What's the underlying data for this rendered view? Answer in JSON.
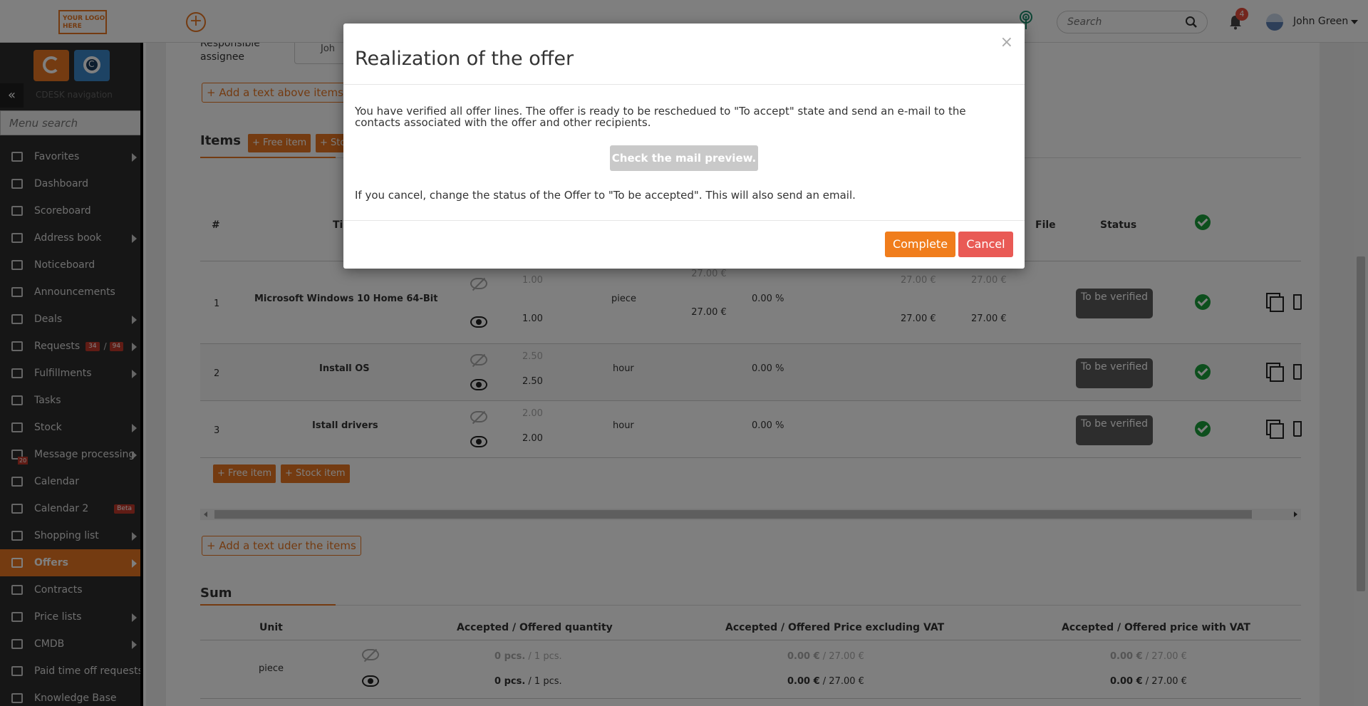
{
  "header": {
    "logo_line1": "YOUR LOGO",
    "logo_line2": "HERE",
    "search_placeholder": "Search",
    "notifications_count": "4",
    "user_name": "John Green"
  },
  "sidebar": {
    "nav_caption": "CDESK navigation",
    "menu_search_placeholder": "Menu search",
    "items": [
      {
        "label": "Favorites",
        "icon": "star-icon",
        "arrow": true
      },
      {
        "label": "Dashboard",
        "icon": "bar-chart-icon",
        "arrow": false
      },
      {
        "label": "Scoreboard",
        "icon": "line-chart-icon",
        "arrow": false
      },
      {
        "label": "Address book",
        "icon": "user-icon",
        "arrow": true
      },
      {
        "label": "Noticeboard",
        "icon": "paper-plane-icon",
        "arrow": false
      },
      {
        "label": "Announcements",
        "icon": "megaphone-icon",
        "arrow": false
      },
      {
        "label": "Deals",
        "icon": "credit-card-icon",
        "arrow": true
      },
      {
        "label": "Requests",
        "icon": "check-circle-icon",
        "arrow": true,
        "badge1": "34",
        "badge2": "94"
      },
      {
        "label": "Fulfillments",
        "icon": "box-icon",
        "arrow": true
      },
      {
        "label": "Tasks",
        "icon": "list-icon",
        "arrow": false
      },
      {
        "label": "Stock",
        "icon": "archive-icon",
        "arrow": true
      },
      {
        "label": "Message processing",
        "icon": "envelope-icon",
        "arrow": true,
        "count": "20"
      },
      {
        "label": "Calendar",
        "icon": "calendar-icon",
        "arrow": false
      },
      {
        "label": "Calendar 2",
        "icon": "calendar-icon",
        "arrow": false,
        "beta": "Beta"
      },
      {
        "label": "Shopping list",
        "icon": "cart-icon",
        "arrow": true
      },
      {
        "label": "Offers",
        "icon": "gift-icon",
        "arrow": true,
        "active": true
      },
      {
        "label": "Contracts",
        "icon": "document-icon",
        "arrow": false
      },
      {
        "label": "Price lists",
        "icon": "document-icon",
        "arrow": true
      },
      {
        "label": "CMDB",
        "icon": "folder-icon",
        "arrow": true
      },
      {
        "label": "Paid time off requests",
        "icon": "plane-icon",
        "arrow": false
      },
      {
        "label": "Knowledge Base",
        "icon": "book-icon",
        "arrow": false
      }
    ]
  },
  "main": {
    "assignee_label": "Responsible assignee",
    "assignee_value": "Joh",
    "add_text_above": "Add a text above items",
    "items_title": "Items",
    "free_item": "Free item",
    "stock_item": "Stock item",
    "stock_item_truncated": "Sto",
    "table_headers": {
      "num": "#",
      "title": "Ti",
      "file": "File",
      "status": "Status"
    },
    "rows": [
      {
        "num": "1",
        "title": "Microsoft Windows 10 Home 64-Bit",
        "qty_old": "1.00",
        "qty": "1.00",
        "unit": "piece",
        "price_old": "27.00 €",
        "price": "27.00 €",
        "discount": "0.00 %",
        "total1_old": "27.00 €",
        "total2_old": "27.00 €",
        "total1": "27.00 €",
        "total2": "27.00 €",
        "status": "To be verified"
      },
      {
        "num": "2",
        "title": "Install OS",
        "qty_old": "2.50",
        "qty": "2.50",
        "unit": "hour",
        "discount": "0.00 %",
        "status": "To be verified"
      },
      {
        "num": "3",
        "title": "Istall drivers",
        "qty_old": "2.00",
        "qty": "2.00",
        "unit": "hour",
        "discount": "0.00 %",
        "status": "To be verified"
      }
    ],
    "add_text_under": "Add a text uder the items",
    "sum_title": "Sum",
    "sum_headers": {
      "unit": "Unit",
      "qty": "Accepted / Offered quantity",
      "price_ex": "Accepted / Offered Price excluding VAT",
      "price_with": "Accepted / Offered price with VAT"
    },
    "sum_rows": [
      {
        "unit": "piece",
        "qty_a": "0 pcs.",
        "qty_o": "/ 1 pcs.",
        "pex_a": "0.00 €",
        "pex_o": "/ 27.00 €",
        "pw_a": "0.00 €",
        "pw_o": "/ 27.00 €"
      },
      {
        "qty_a": "0 pcs.",
        "qty_o": "/ 1 pcs.",
        "pex_a": "0.00 €",
        "pex_o": "/ 27.00 €",
        "pw_a": "0.00 €",
        "pw_o": "/ 27.00 €"
      }
    ]
  },
  "modal": {
    "title": "Realization of the offer",
    "close": "×",
    "message": "You have verified all offer lines. The offer is ready to be reschedued to \"To accept\" state and send an e-mail to the contacts associated with the offer and other recipients.",
    "preview_button": "Check the mail preview.",
    "cancel_note": "If you cancel, change the status of the Offer to \"To be accepted\". This will also send an email.",
    "complete_button": "Complete",
    "cancel_button": "Cancel"
  },
  "colors": {
    "accent": "#e87722",
    "sidebar": "#2d2d2d",
    "success": "#1a9e3a",
    "danger": "#e95a55"
  }
}
